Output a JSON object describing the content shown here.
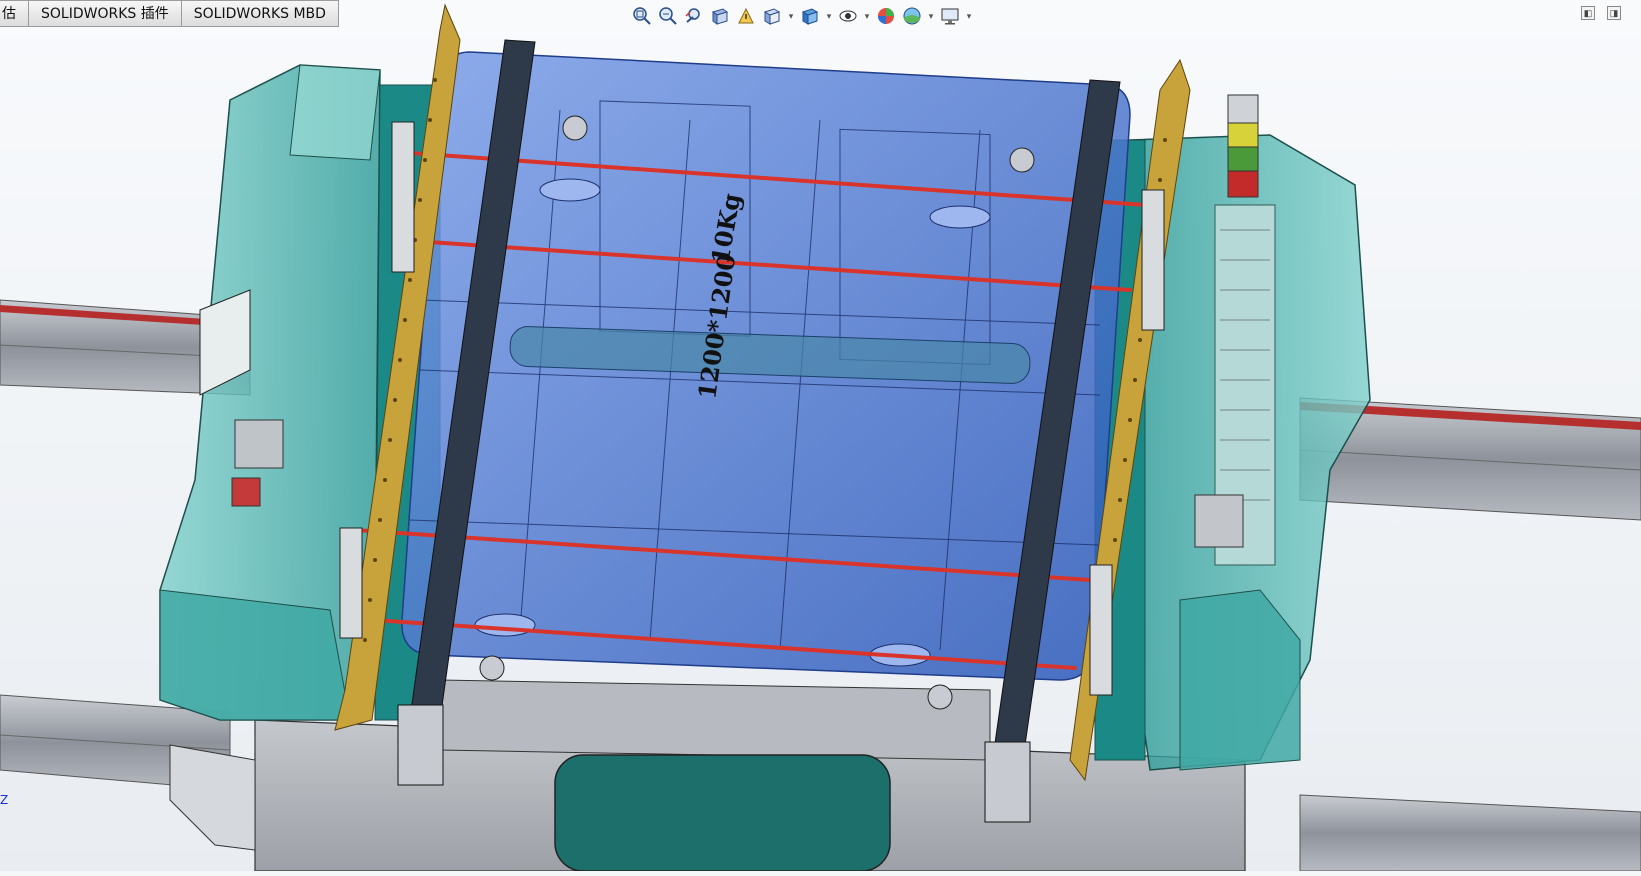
{
  "tabs": [
    "估",
    "SOLIDWORKS 插件",
    "SOLIDWORKS MBD"
  ],
  "hud_tools": [
    {
      "icon": "zoom-to-fit-icon",
      "dropdown": false
    },
    {
      "icon": "zoom-to-area-icon",
      "dropdown": false
    },
    {
      "icon": "previous-view-icon",
      "dropdown": false
    },
    {
      "icon": "section-view-icon",
      "dropdown": false
    },
    {
      "icon": "dynamic-annotation-view-icon",
      "dropdown": false
    },
    {
      "icon": "view-orientation-icon",
      "dropdown": true
    },
    {
      "icon": "display-style-icon",
      "dropdown": true
    },
    {
      "icon": "hide-show-items-icon",
      "dropdown": true
    },
    {
      "icon": "edit-appearance-icon",
      "dropdown": false
    },
    {
      "icon": "apply-scene-icon",
      "dropdown": true
    },
    {
      "icon": "view-settings-icon",
      "dropdown": true
    }
  ],
  "window_controls": [
    "restore-icon",
    "maximize-icon"
  ],
  "model_annotations": {
    "weight": "10Kg",
    "size": "1200*1200"
  },
  "triad_label": "Z",
  "colors": {
    "teal": "#1e8c8a",
    "glass_teal": "#5fb8b4",
    "glass_blue": "#3a6fd1",
    "gold": "#c8a23a",
    "red_bar": "#d9342b",
    "steel": "#9aa0a8",
    "viewport_bg": "#f4f6f8"
  }
}
